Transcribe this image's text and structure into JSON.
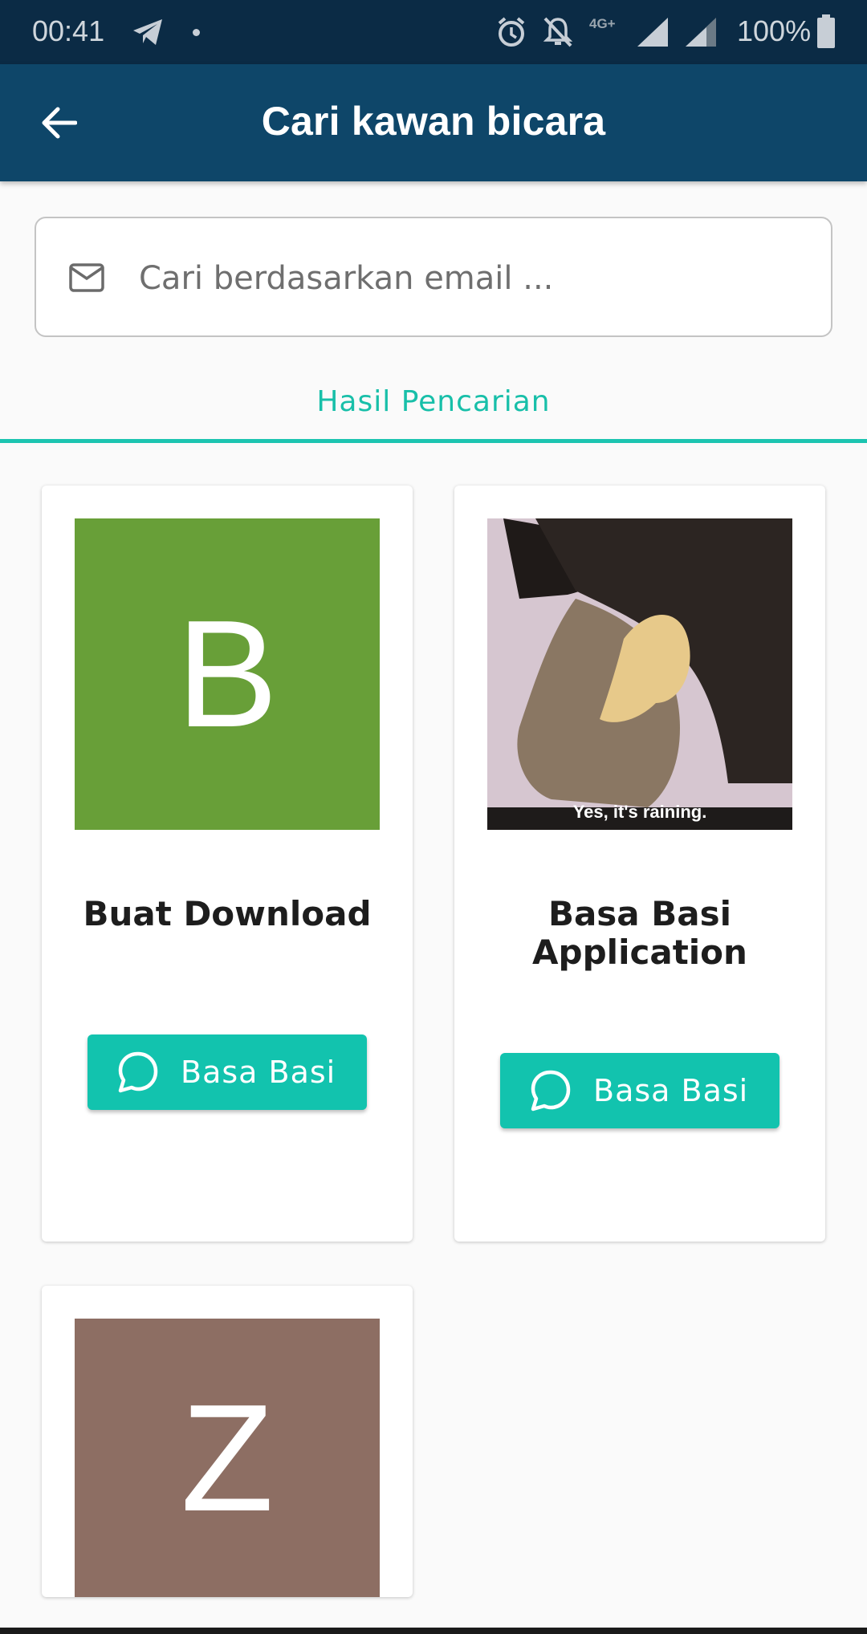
{
  "status_bar": {
    "time": "00:41",
    "network": "4G+",
    "battery": "100%"
  },
  "app_bar": {
    "title": "Cari kawan bicara"
  },
  "search": {
    "placeholder": "Cari berdasarkan email ...",
    "value": ""
  },
  "tab": {
    "label": "Hasil Pencarian"
  },
  "results": [
    {
      "name": "Buat Download",
      "avatar_letter": "B",
      "avatar_color": "#689f38",
      "button_label": "Basa Basi"
    },
    {
      "name": "Basa Basi Application",
      "avatar_caption": "Yes, it's raining.",
      "button_label": "Basa Basi"
    },
    {
      "avatar_letter": "Z",
      "avatar_color": "#8d6e63"
    }
  ],
  "colors": {
    "status_bar": "#0b2b45",
    "app_bar": "#0e4669",
    "accent": "#12c3ae"
  },
  "icons": [
    "back-arrow-icon",
    "mail-icon",
    "chat-bubble-icon",
    "telegram-icon",
    "alarm-icon",
    "bell-off-icon",
    "signal-icon",
    "battery-icon"
  ]
}
